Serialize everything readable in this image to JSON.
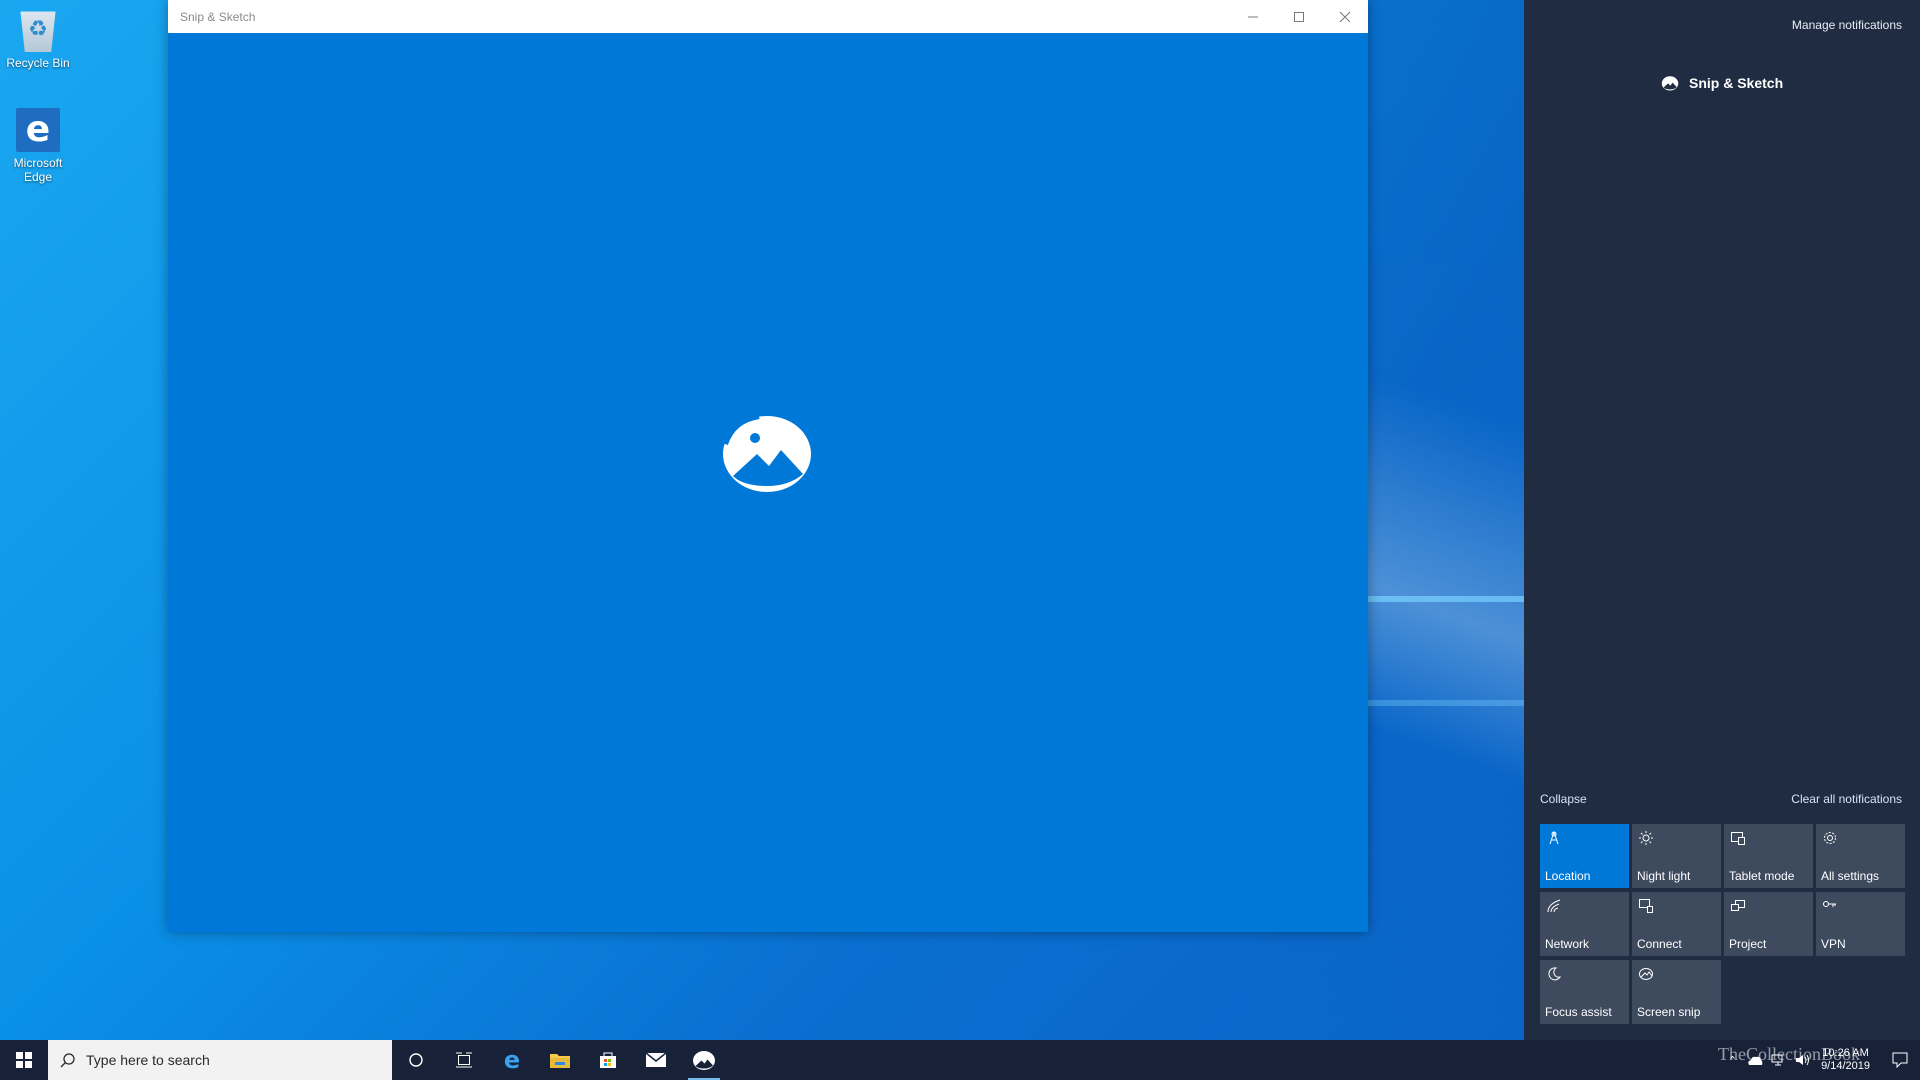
{
  "desktop": {
    "icons": [
      {
        "label": "Recycle Bin"
      },
      {
        "label": "Microsoft Edge"
      }
    ]
  },
  "window": {
    "title": "Snip & Sketch",
    "background": "#0078d7"
  },
  "action_center": {
    "manage_label": "Manage notifications",
    "app_name": "Snip & Sketch",
    "collapse_label": "Collapse",
    "clear_label": "Clear all notifications",
    "tiles": [
      {
        "label": "Location",
        "icon": "location-icon",
        "active": true
      },
      {
        "label": "Night light",
        "icon": "night-light-icon",
        "active": false
      },
      {
        "label": "Tablet mode",
        "icon": "tablet-mode-icon",
        "active": false
      },
      {
        "label": "All settings",
        "icon": "gear-icon",
        "active": false
      },
      {
        "label": "Network",
        "icon": "network-icon",
        "active": false
      },
      {
        "label": "Connect",
        "icon": "connect-icon",
        "active": false
      },
      {
        "label": "Project",
        "icon": "project-icon",
        "active": false
      },
      {
        "label": "VPN",
        "icon": "vpn-icon",
        "active": false
      },
      {
        "label": "Focus assist",
        "icon": "moon-icon",
        "active": false
      },
      {
        "label": "Screen snip",
        "icon": "screen-snip-icon",
        "active": false
      }
    ]
  },
  "taskbar": {
    "search_placeholder": "Type here to search",
    "time": "10:26 AM",
    "date": "9/14/2019",
    "watermark": "TheCollectionBook"
  }
}
